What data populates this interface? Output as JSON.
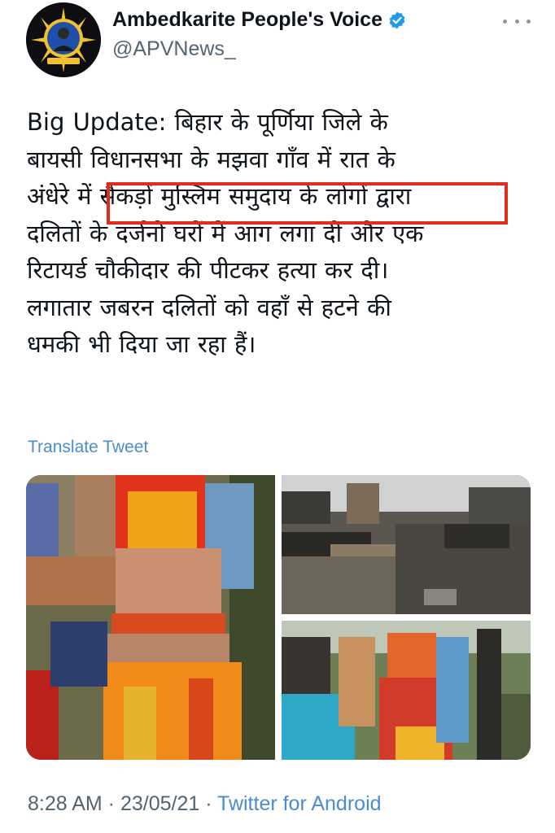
{
  "account": {
    "display_name": "Ambedkarite People's Voice",
    "handle": "@APVNews_",
    "verified": true,
    "verified_color": "#1d9bf0"
  },
  "tweet": {
    "lines": [
      "Big Update: बिहार के पूर्णिया जिले के",
      "बायसी विधानसभा के मझवा गाँव में रात के",
      "अंधेरे में सैकड़ों मुस्लिम समुदाय के लोगों द्वारा",
      "दलितों के दर्जनो घरों में आग लगा दी और एक",
      "रिटायर्ड चौकीदार की पीटकर हत्या कर दी।",
      "लगातार जबरन दलितों को वहाँ से हटने की",
      "धमकी भी दिया जा रहा हैं।"
    ],
    "highlight_color": "#e32b1c"
  },
  "translate_label": "Translate Tweet",
  "media": [
    {
      "id": "photo-woman-back"
    },
    {
      "id": "photo-burnt-houses"
    },
    {
      "id": "photo-crowd"
    }
  ],
  "meta": {
    "time": "8:28 AM",
    "separator": " · ",
    "date": "23/05/21",
    "source": "Twitter for Android"
  },
  "colors": {
    "text": "#0f1419",
    "secondary": "#536471",
    "link": "#4b8bd0"
  }
}
